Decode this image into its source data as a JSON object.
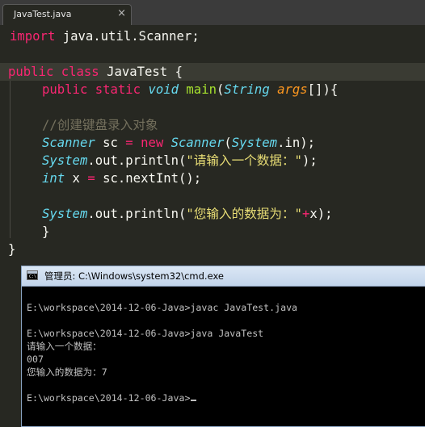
{
  "editor": {
    "tab": {
      "label": "JavaTest.java",
      "close_glyph": "×"
    },
    "code": {
      "l1": {
        "kw": "import",
        "rest": " java.util.Scanner;"
      },
      "l3": {
        "kw1": "public",
        "kw2": "class",
        "rest": " JavaTest {"
      },
      "l4": {
        "kw1": "public",
        "kw2": "static",
        "ty": "void",
        "fn": "main",
        "p1": "(",
        "ty2": "String",
        "arg": "args",
        "p2": "[]){"
      },
      "l6": {
        "comment": "//创建键盘录入对象"
      },
      "l7": {
        "ty": "Scanner",
        "p1": " sc ",
        "op": "=",
        "kw": "new",
        "ty2": "Scanner",
        "p2": "(",
        "ty3": "System",
        "p3": ".in);"
      },
      "l8": {
        "ty": "System",
        "p1": ".out.println(",
        "str": "\"请输入一个数据：\"",
        "p2": ");"
      },
      "l9": {
        "ty": "int",
        "p1": " x ",
        "op": "=",
        "p2": " sc.nextInt();"
      },
      "l11": {
        "ty": "System",
        "p1": ".out.println(",
        "str": "\"您输入的数据为：\"",
        "op": "+",
        "p2": "x);"
      },
      "l12": {
        "p": "}"
      },
      "l13": {
        "p": "}"
      }
    }
  },
  "cmd": {
    "title": "管理员: C:\\Windows\\system32\\cmd.exe",
    "lines": [
      "E:\\workspace\\2014-12-06-Java>javac JavaTest.java",
      "E:\\workspace\\2014-12-06-Java>java JavaTest",
      "请输入一个数据：",
      "007",
      "您输入的数据为：7",
      "E:\\workspace\\2014-12-06-Java>"
    ]
  },
  "colors": {
    "editor_bg": "#272822",
    "keyword": "#f92672",
    "type": "#66d9ef",
    "function": "#a6e22e",
    "argument": "#fd971f",
    "string": "#e6db74",
    "comment": "#75715e",
    "console_bg": "#000000",
    "console_fg": "#c0c0c0"
  }
}
